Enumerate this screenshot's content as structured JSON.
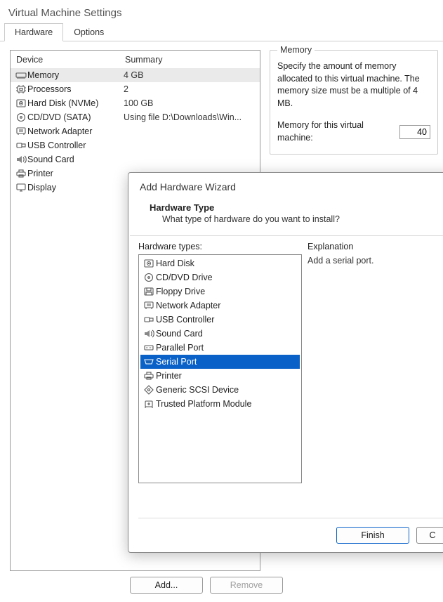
{
  "window": {
    "title": "Virtual Machine Settings",
    "tabs": [
      "Hardware",
      "Options"
    ]
  },
  "devices": {
    "columns": [
      "Device",
      "Summary"
    ],
    "rows": [
      {
        "icon": "memory",
        "name": "Memory",
        "summary": "4 GB",
        "selected": true
      },
      {
        "icon": "cpu",
        "name": "Processors",
        "summary": "2"
      },
      {
        "icon": "disk",
        "name": "Hard Disk (NVMe)",
        "summary": "100 GB"
      },
      {
        "icon": "cd",
        "name": "CD/DVD (SATA)",
        "summary": "Using file D:\\Downloads\\Win..."
      },
      {
        "icon": "net",
        "name": "Network Adapter",
        "summary": ""
      },
      {
        "icon": "usb",
        "name": "USB Controller",
        "summary": ""
      },
      {
        "icon": "sound",
        "name": "Sound Card",
        "summary": ""
      },
      {
        "icon": "printer",
        "name": "Printer",
        "summary": ""
      },
      {
        "icon": "display",
        "name": "Display",
        "summary": ""
      }
    ],
    "buttons": {
      "add": "Add...",
      "remove": "Remove"
    }
  },
  "memory": {
    "group_label": "Memory",
    "description": "Specify the amount of memory allocated to this virtual machine. The memory size must be a multiple of 4 MB.",
    "field_label": "Memory for this virtual machine:",
    "value": "40"
  },
  "wizard": {
    "title": "Add Hardware Wizard",
    "heading": "Hardware Type",
    "question": "What type of hardware do you want to install?",
    "list_label": "Hardware types:",
    "explanation_label": "Explanation",
    "explanation_text": "Add a serial port.",
    "items": [
      {
        "icon": "disk",
        "label": "Hard Disk"
      },
      {
        "icon": "cd",
        "label": "CD/DVD Drive"
      },
      {
        "icon": "floppy",
        "label": "Floppy Drive"
      },
      {
        "icon": "net",
        "label": "Network Adapter"
      },
      {
        "icon": "usb",
        "label": "USB Controller"
      },
      {
        "icon": "sound",
        "label": "Sound Card"
      },
      {
        "icon": "parallel",
        "label": "Parallel Port"
      },
      {
        "icon": "serial",
        "label": "Serial Port",
        "selected": true
      },
      {
        "icon": "printer",
        "label": "Printer"
      },
      {
        "icon": "scsi",
        "label": "Generic SCSI Device"
      },
      {
        "icon": "tpm",
        "label": "Trusted Platform Module"
      }
    ],
    "buttons": {
      "finish": "Finish",
      "cancel": "C"
    }
  },
  "icons": {
    "memory": "<svg viewBox='0 0 16 14'><rect x='1' y='4' width='14' height='6' rx='1'/><path d='M3 10v2M5 10v2M7 10v2M9 10v2M11 10v2M13 10v2'/></svg>",
    "cpu": "<svg viewBox='0 0 16 14'><rect x='3' y='3' width='10' height='8' rx='1'/><rect x='6' y='5.5' width='4' height='3'/><path d='M1 5h2M1 9h2M13 5h2M13 9h2M5 1v2M11 1v2M5 11v2M11 11v2'/></svg>",
    "disk": "<svg viewBox='0 0 16 14'><rect x='2' y='2' width='12' height='10' rx='1'/><circle cx='8' cy='7' r='2.5'/><circle cx='8' cy='7' r='.6' fill='#555'/></svg>",
    "cd": "<svg viewBox='0 0 16 14'><circle cx='8' cy='7' r='5.5'/><circle cx='8' cy='7' r='1.3'/></svg>",
    "net": "<svg viewBox='0 0 16 14'><rect x='2' y='2' width='12' height='8' rx='1'/><path d='M5 5h6M5 7h6'/><path d='M4 10v2M12 10v2'/></svg>",
    "usb": "<svg viewBox='0 0 16 14'><rect x='2' y='4' width='7' height='6' rx='1'/><rect x='9' y='5' width='5' height='4'/></svg>",
    "sound": "<svg viewBox='0 0 16 14'><path d='M2 5v4h3l4 3V2L5 5z' fill='#888' stroke='none'/><path d='M11 4c1.5 1 1.5 5 0 6M13 2c3 2 3 8 0 10'/></svg>",
    "printer": "<svg viewBox='0 0 16 14'><rect x='2' y='5' width='12' height='5' rx='1'/><rect x='5' y='2' width='6' height='3'/><rect x='5' y='9' width='6' height='3'/></svg>",
    "display": "<svg viewBox='0 0 16 14'><rect x='2' y='2' width='12' height='8' rx='1'/><path d='M6 12h4M8 10v2'/></svg>",
    "floppy": "<svg viewBox='0 0 16 14'><rect x='2' y='2' width='12' height='10' rx='1'/><rect x='5' y='2' width='6' height='4'/><rect x='4' y='8' width='8' height='4'/></svg>",
    "parallel": "<svg viewBox='0 0 16 14'><rect x='2' y='4' width='12' height='6' rx='1'/><path d='M4 7h1M6 7h1M8 7h1M10 7h1M12 7h0.5'/></svg>",
    "serial": "<svg viewBox='0 0 16 14'><path d='M2 4h12l-2 6H4z'/><circle cx='5' cy='6' r='.6' fill='#555' stroke='none'/><circle cx='8' cy='6' r='.6' fill='#555' stroke='none'/><circle cx='11' cy='6' r='.6' fill='#555' stroke='none'/><circle cx='6.5' cy='8' r='.6' fill='#555' stroke='none'/><circle cx='9.5' cy='8' r='.6' fill='#555' stroke='none'/></svg>",
    "scsi": "<svg viewBox='0 0 16 14'><path d='M8 1l6 6-6 6-6-6z'/><circle cx='8' cy='7' r='1.5'/></svg>",
    "tpm": "<svg viewBox='0 0 16 14'><rect x='3' y='3' width='10' height='8' rx='1'/><path d='M6 7h4M8 5v4'/><path d='M3 11v2M13 11v2'/></svg>"
  }
}
